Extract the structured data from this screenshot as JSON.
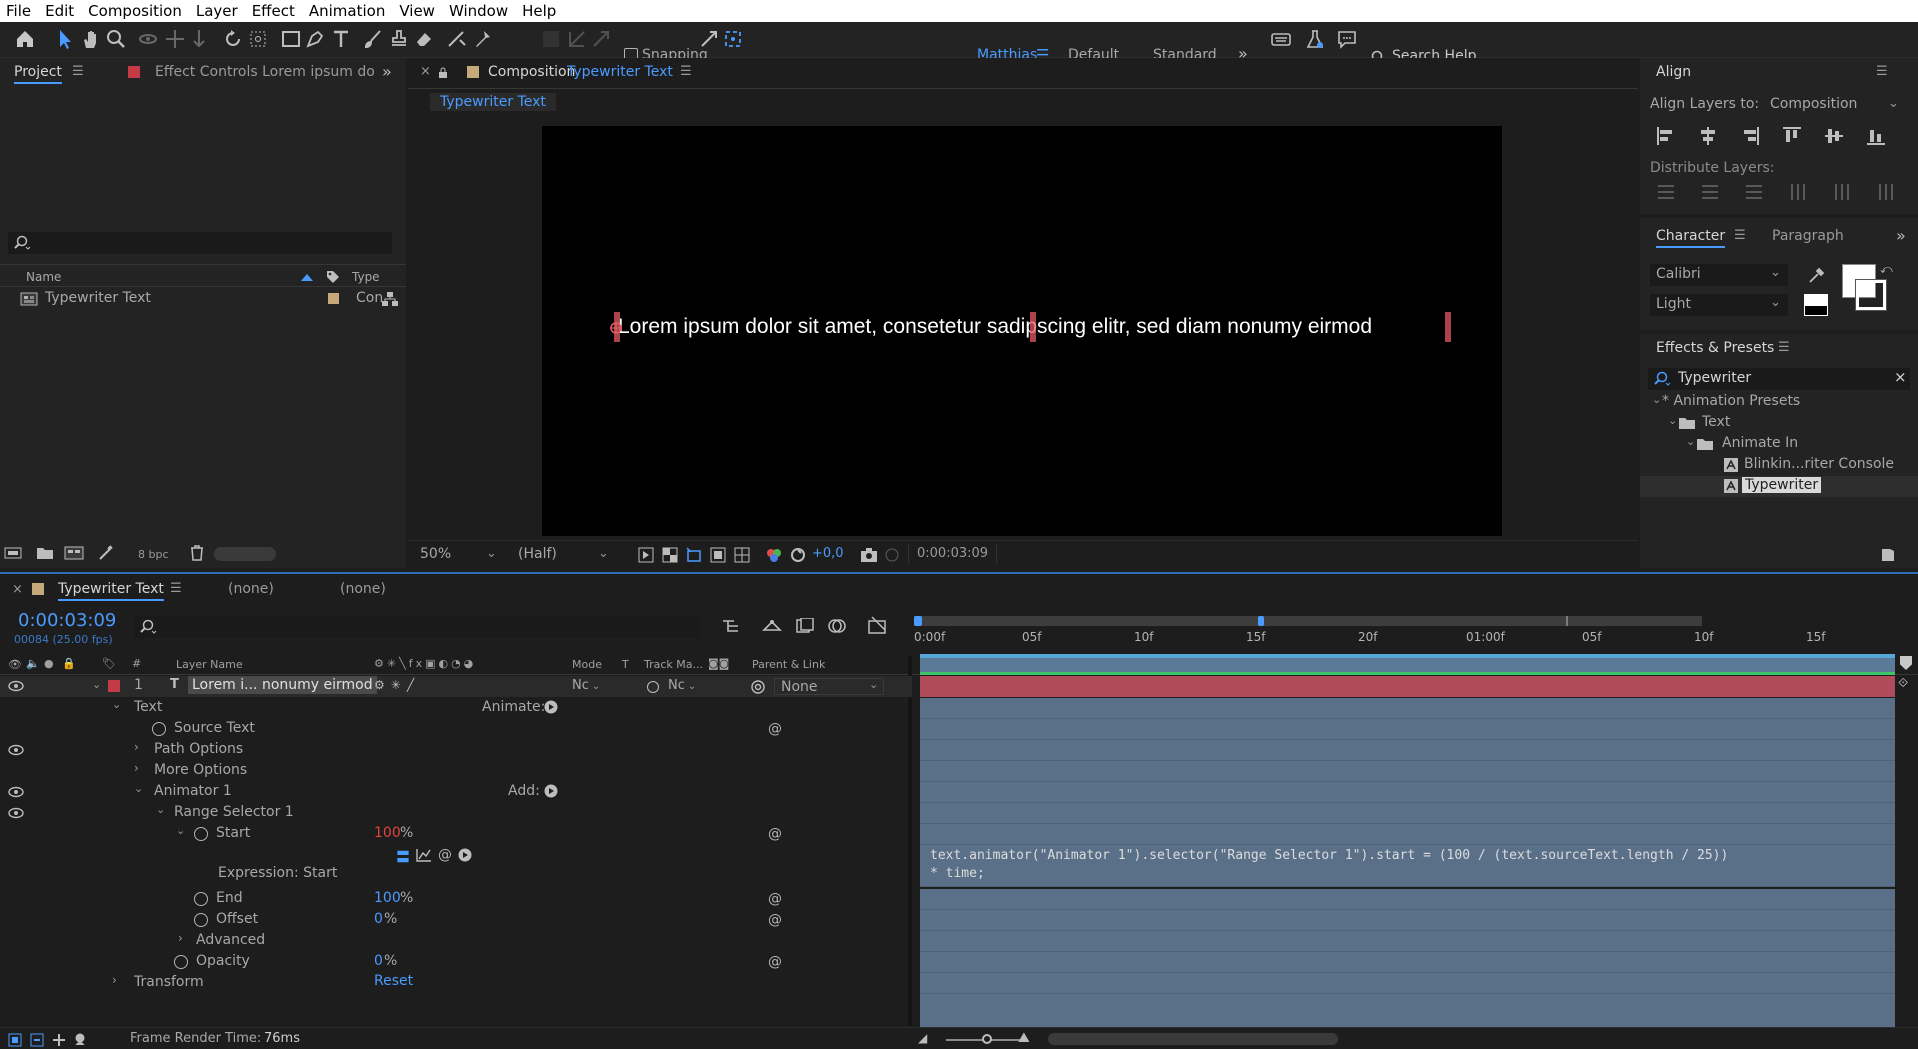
{
  "menubar": [
    "File",
    "Edit",
    "Composition",
    "Layer",
    "Effect",
    "Animation",
    "View",
    "Window",
    "Help"
  ],
  "toolbar": {
    "snapping_label": "Snapping",
    "workspaces": [
      "Matthias",
      "Default",
      "Standard"
    ],
    "search_placeholder": "Search Help"
  },
  "project_panel": {
    "tab_project": "Project",
    "tab_effect_controls": "Effect Controls Lorem ipsum do",
    "col_name": "Name",
    "col_type": "Type",
    "item_name": "Typewriter Text",
    "item_type": "Con",
    "bpc": "8 bpc"
  },
  "composition_panel": {
    "tab_prefix": "Composition",
    "tab_name": "Typewriter Text",
    "breadcrumb": "Typewriter Text",
    "canvas_text": "Lorem ipsum dolor sit amet, consetetur sadipscing elitr, sed diam nonumy eirmod",
    "zoom": "50%",
    "resolution": "(Half)",
    "exposure": "+0,0",
    "timecode": "0:00:03:09"
  },
  "align_panel": {
    "title": "Align",
    "align_to_label": "Align Layers to:",
    "align_to_value": "Composition",
    "distribute_label": "Distribute Layers:"
  },
  "character_panel": {
    "tab_character": "Character",
    "tab_paragraph": "Paragraph",
    "font": "Calibri",
    "style": "Light"
  },
  "effects_presets": {
    "title": "Effects & Presets",
    "search_value": "Typewriter",
    "tree": [
      {
        "label": "* Animation Presets",
        "indent": 0,
        "kind": "root"
      },
      {
        "label": "Text",
        "indent": 1,
        "kind": "folder"
      },
      {
        "label": "Animate In",
        "indent": 2,
        "kind": "folder"
      },
      {
        "label": "Blinkin...riter Console",
        "indent": 3,
        "kind": "preset"
      },
      {
        "label": "Typewriter",
        "indent": 3,
        "kind": "preset-selected"
      }
    ]
  },
  "timeline": {
    "tab_name": "Typewriter Text",
    "none1": "(none)",
    "none2": "(none)",
    "timecode": "0:00:03:09",
    "frame_info": "00084 (25.00 fps)",
    "ruler_labels": [
      "0:00f",
      "05f",
      "10f",
      "15f",
      "20f",
      "01:00f",
      "05f",
      "10f",
      "15f"
    ],
    "columns": {
      "layer_name": "Layer Name",
      "mode": "Mode",
      "t": "T",
      "track_matte": "Track Ma...",
      "parent_link": "Parent & Link"
    },
    "layer": {
      "number": "1",
      "name": "Lorem i... nonumy eirmod",
      "mode": "Nc",
      "track": "Nc",
      "parent": "None"
    },
    "rows": {
      "text": "Text",
      "animate_label": "Animate:",
      "source_text": "Source Text",
      "path_options": "Path Options",
      "more_options": "More Options",
      "animator1": "Animator 1",
      "add_label": "Add:",
      "range_selector": "Range Selector 1",
      "start": "Start",
      "start_value": "100",
      "expression_label": "Expression: Start",
      "end": "End",
      "end_value": "100",
      "offset": "Offset",
      "offset_value": "0",
      "advanced": "Advanced",
      "opacity": "Opacity",
      "opacity_value": "0",
      "transform": "Transform",
      "reset": "Reset",
      "percent": "%"
    },
    "expression_line1": "text.animator(\"Animator 1\").selector(\"Range Selector 1\").start = (100 / (text.sourceText.length / 25))",
    "expression_line2": "* time;",
    "frame_render_label": "Frame Render Time:",
    "frame_render_value": "76ms"
  }
}
